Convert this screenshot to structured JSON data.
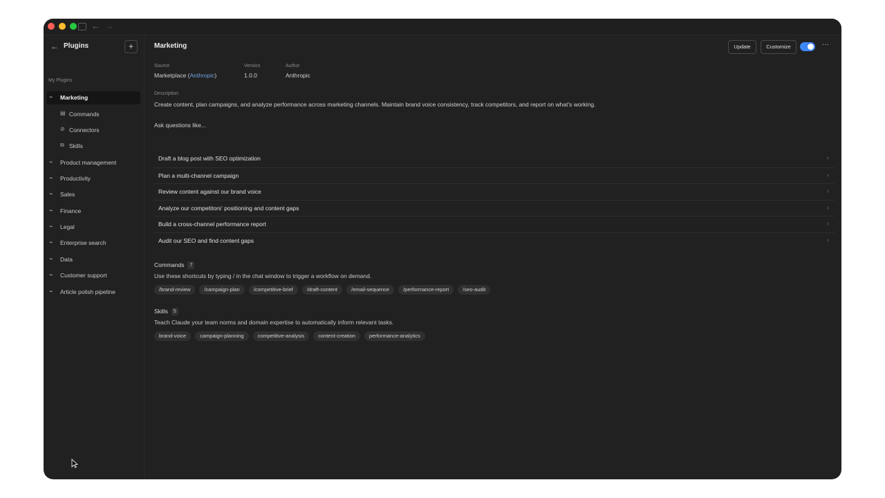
{
  "titlebar": {
    "back_arrow": "←",
    "forward_arrow": "→"
  },
  "sidebar": {
    "title": "Plugins",
    "add_symbol": "+",
    "back_symbol": "←",
    "group_label": "My Plugins",
    "items": [
      {
        "label": "Marketing",
        "icon": "plug-icon"
      },
      {
        "label": "Commands",
        "icon": "commands-icon"
      },
      {
        "label": "Connectors",
        "icon": "connector-icon"
      },
      {
        "label": "Skills",
        "icon": "skills-icon"
      },
      {
        "label": "Product management",
        "icon": "plug-icon"
      },
      {
        "label": "Productivity",
        "icon": "plug-icon"
      },
      {
        "label": "Sales",
        "icon": "plug-icon"
      },
      {
        "label": "Finance",
        "icon": "plug-icon"
      },
      {
        "label": "Legal",
        "icon": "plug-icon"
      },
      {
        "label": "Enterprise search",
        "icon": "plug-icon"
      },
      {
        "label": "Data",
        "icon": "plug-icon"
      },
      {
        "label": "Customer support",
        "icon": "plug-icon"
      },
      {
        "label": "Article polish pipeline",
        "icon": "plug-icon"
      }
    ]
  },
  "header": {
    "title": "Marketing",
    "update_label": "Update",
    "customize_label": "Customize",
    "enabled": true,
    "more_symbol": "···"
  },
  "meta": {
    "source_label": "Source",
    "source_prefix": "Marketplace (",
    "source_link": "Anthropic",
    "source_suffix": ")",
    "version_label": "Version",
    "version_value": "1.0.0",
    "author_label": "Author",
    "author_value": "Anthropic"
  },
  "description": {
    "label": "Description",
    "text": "Create content, plan campaigns, and analyze performance across marketing channels. Maintain brand voice consistency, track competitors, and report on what's working."
  },
  "ask": {
    "label": "Ask questions like...",
    "prompts": [
      "Draft a blog post with SEO optimization",
      "Plan a multi-channel campaign",
      "Review content against our brand voice",
      "Analyze our competitors' positioning and content gaps",
      "Build a cross-channel performance report",
      "Audit our SEO and find content gaps"
    ]
  },
  "commands": {
    "title": "Commands",
    "count": "7",
    "description": "Use these shortcuts by typing / in the chat window to trigger a workflow on demand.",
    "items": [
      "/brand-review",
      "/campaign-plan",
      "/competitive-brief",
      "/draft-content",
      "/email-sequence",
      "/performance-report",
      "/seo-audit"
    ]
  },
  "skills": {
    "title": "Skills",
    "count": "5",
    "description": "Teach Claude your team norms and domain expertise to automatically inform relevant tasks.",
    "items": [
      "brand-voice",
      "campaign-planning",
      "competitive-analysis",
      "content-creation",
      "performance-analytics"
    ]
  },
  "colors": {
    "window_bg": "#212121",
    "accent": "#3d86f5",
    "link": "#6fa3e0"
  }
}
